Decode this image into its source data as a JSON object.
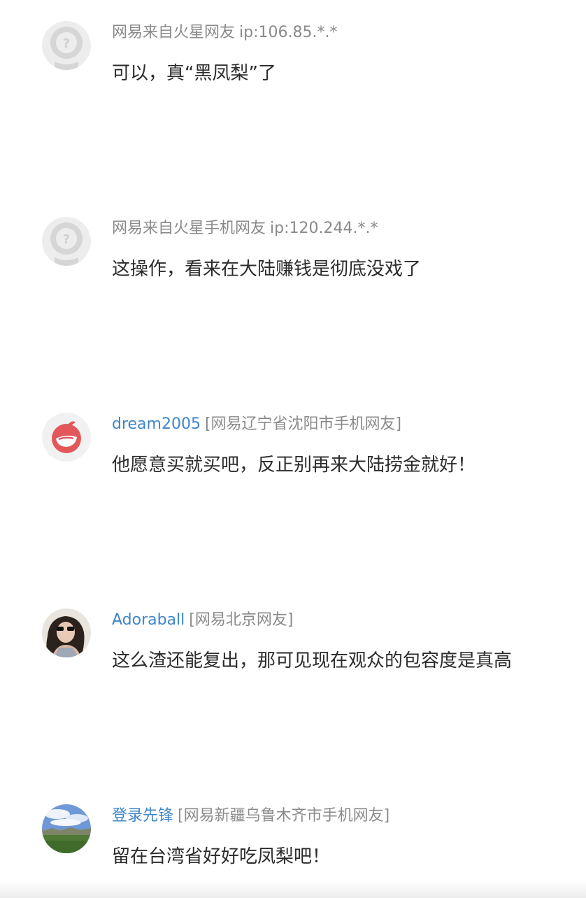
{
  "comments": [
    {
      "user": "网易来自火星网友",
      "location": "ip:106.85.*.*",
      "text": "可以，真“黑凤梨”了",
      "avatar": "default-user-icon"
    },
    {
      "user": "网易来自火星手机网友",
      "location": "ip:120.244.*.*",
      "text": "这操作，看来在大陆赚钱是彻底没戏了",
      "avatar": "default-user-icon"
    },
    {
      "user": "dream2005",
      "location": "[网易辽宁省沈阳市手机网友]",
      "text": "他愿意买就买吧，反正别再来大陆捞金就好！",
      "avatar": "red-logo-avatar"
    },
    {
      "user": "Adoraball",
      "location": "[网易北京网友]",
      "text": "这么渣还能复出，那可见现在观众的包容度是真高",
      "avatar": "photo-avatar"
    },
    {
      "user": "登录先锋",
      "location": "[网易新疆乌鲁木齐市手机网友]",
      "text": "留在台湾省好好吃凤梨吧！",
      "avatar": "landscape-avatar"
    }
  ],
  "colors": {
    "username_link": "#3f86c8",
    "meta_gray": "#8a8a8a",
    "text": "#2b2b2b"
  }
}
